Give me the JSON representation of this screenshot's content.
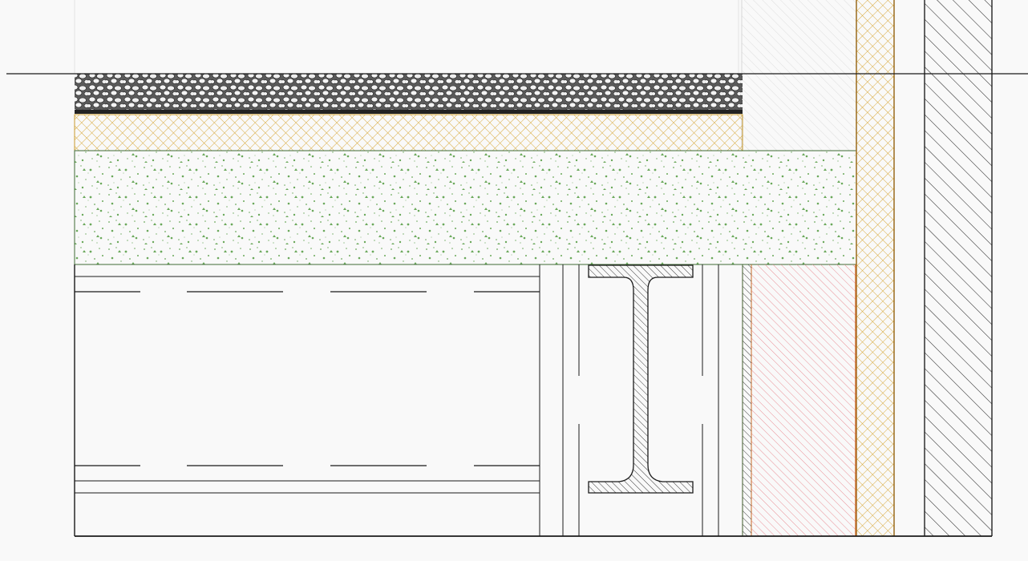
{
  "drawing": {
    "view": "construction-section-detail",
    "background": "#f9f9f9",
    "line_color": "#1a1a1a",
    "materials": {
      "gravel": {
        "fill": "#5a5a5a",
        "pattern": "pebbles"
      },
      "insulation": {
        "stroke": "#d8a93b",
        "pattern": "crosshatch"
      },
      "concrete": {
        "fill": "#6aa85a",
        "pattern": "speckle"
      },
      "masonry": {
        "stroke": "#e8848c",
        "pattern": "diagonal-hatch"
      },
      "wall": {
        "stroke": "#2a2a2a",
        "pattern": "diagonal-hatch"
      },
      "steel": {
        "stroke": "#2a2a2a",
        "pattern": "diagonal-hatch"
      },
      "finish": {
        "stroke": "#d9d9d9",
        "pattern": "light-hatch"
      }
    }
  }
}
